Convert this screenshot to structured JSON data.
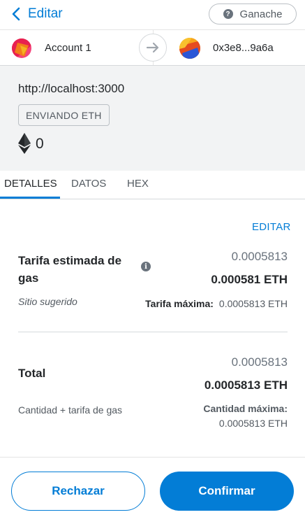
{
  "header": {
    "back_label": "Editar",
    "network_label": "Ganache",
    "network_icon": "question-icon"
  },
  "accounts": {
    "from": "Account 1",
    "to": "0x3e8...9a6a"
  },
  "summary": {
    "origin": "http://localhost:3000",
    "action": "ENVIANDO ETH",
    "amount": "0",
    "currency_icon": "eth-icon"
  },
  "tabs": [
    "DETALLES",
    "DATOS",
    "HEX"
  ],
  "details": {
    "edit_label": "EDITAR",
    "gas": {
      "label": "Tarifa estimada de gas",
      "info_icon": "info-icon",
      "secondary": "0.0005813",
      "primary": "0.000581 ETH",
      "subtitle": "Sitio sugerido",
      "max_label": "Tarifa máxima:",
      "max_value": "0.0005813 ETH"
    },
    "total": {
      "label": "Total",
      "secondary": "0.0005813",
      "primary": "0.0005813 ETH",
      "subtitle": "Cantidad + tarifa de gas",
      "max_label": "Cantidad máxima:",
      "max_value": "0.0005813 ETH"
    }
  },
  "actions": {
    "reject": "Rechazar",
    "confirm": "Confirmar"
  },
  "colors": {
    "accent": "#037dd6",
    "summary_bg": "#f2f3f4",
    "text": "#24272a",
    "muted": "#6a737d"
  }
}
